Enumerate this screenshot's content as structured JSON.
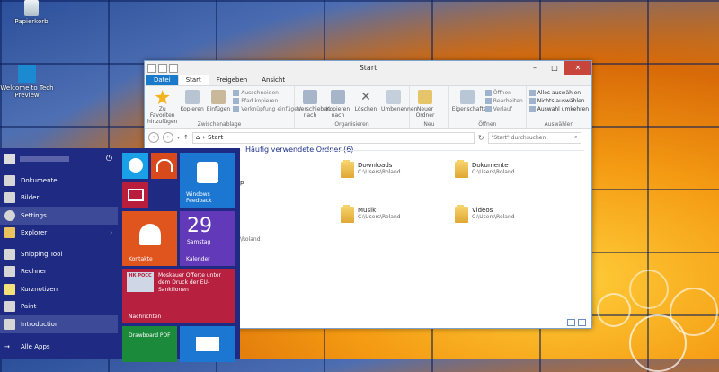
{
  "desktop": {
    "icons": [
      {
        "label": "Papierkorb"
      },
      {
        "label": "Welcome to Tech Preview"
      }
    ]
  },
  "explorer": {
    "title": "Start",
    "tabs": [
      "Datei",
      "Start",
      "Freigeben",
      "Ansicht"
    ],
    "ribbon": {
      "clipboard": {
        "pin": "Zu Favoriten hinzufügen",
        "copy": "Kopieren",
        "paste": "Einfügen",
        "cut": "Ausschneiden",
        "copy_path": "Pfad kopieren",
        "paste_shortcut": "Verknüpfung einfügen",
        "label": "Zwischenablage"
      },
      "organize": {
        "move": "Verschieben nach",
        "copyto": "Kopieren nach",
        "delete": "Löschen",
        "rename": "Umbenennen",
        "label": "Organisieren"
      },
      "new": {
        "newfolder": "Neuer Ordner",
        "label": "Neu"
      },
      "open": {
        "properties": "Eigenschaften",
        "open": "Öffnen",
        "edit": "Bearbeiten",
        "history": "Verlauf",
        "label": "Öffnen"
      },
      "select": {
        "all": "Alles auswählen",
        "none": "Nichts auswählen",
        "invert": "Auswahl umkehren",
        "label": "Auswählen"
      }
    },
    "address": {
      "path": "Start",
      "search_placeholder": "\"Start\" durchsuchen"
    },
    "section_title": "Häufig verwendete Ordner (6)",
    "folders": [
      {
        "name": "Downloads",
        "path": "C:\\Users\\Roland"
      },
      {
        "name": "Dokumente",
        "path": "C:\\Users\\Roland"
      },
      {
        "name": "Musik",
        "path": "C:\\Users\\Roland"
      },
      {
        "name": "Videos",
        "path": "C:\\Users\\Roland"
      }
    ],
    "partial": {
      "p1": "p",
      "p2": "\\Roland"
    }
  },
  "startmenu": {
    "items": [
      {
        "label": "Dokumente"
      },
      {
        "label": "Bilder"
      },
      {
        "label": "Settings"
      },
      {
        "label": "Explorer"
      },
      {
        "label": "Snipping Tool"
      },
      {
        "label": "Rechner"
      },
      {
        "label": "Kurznotizen"
      },
      {
        "label": "Paint"
      },
      {
        "label": "Introduction"
      }
    ],
    "all_apps": "Alle Apps",
    "tiles": {
      "feedback": "Windows Feedback",
      "contacts": "Kontakte",
      "cal_day": "29",
      "cal_weekday": "Samstag",
      "calendar": "Kalender",
      "news_headline": "Moskauer Offerte unter dem Druck der EU-Sanktionen",
      "news": "Nachrichten",
      "drawboard": "Drawboard PDF",
      "ru_badge": "НК РОСС"
    }
  }
}
